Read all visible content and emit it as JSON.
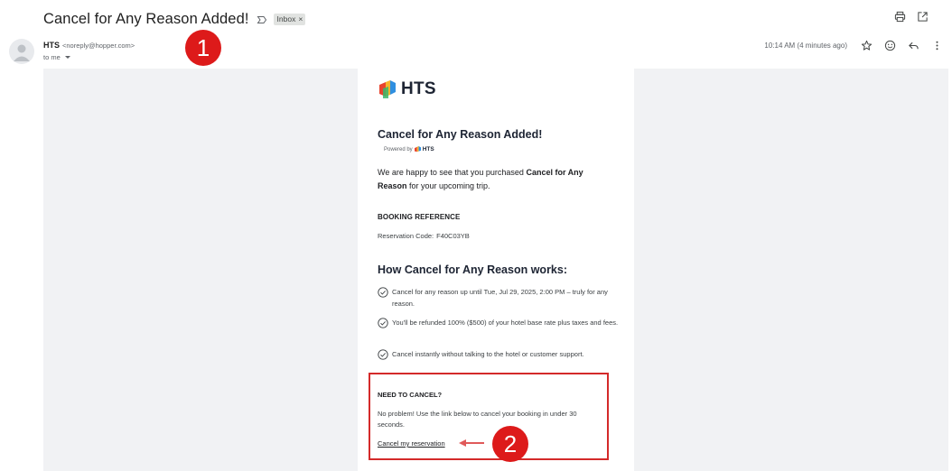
{
  "email": {
    "subject": "Cancel for Any Reason Added!",
    "label": "Inbox",
    "label_close": "×",
    "sender_name": "HTS",
    "sender_email": "<noreply@hopper.com>",
    "to_line": "to me",
    "timestamp": "10:14 AM (4 minutes ago)"
  },
  "body": {
    "logo_text": "HTS",
    "heading": "Cancel for Any Reason Added!",
    "powered_by": "Powered by",
    "powered_brand": "HTS",
    "intro_part1": "We are happy to see that you purchased ",
    "intro_bold": "Cancel for Any Reason",
    "intro_part2": " for your upcoming trip.",
    "booking_heading": "BOOKING REFERENCE",
    "reservation_label": "Reservation Code:",
    "reservation_code": "F40C03YB",
    "how_heading": "How Cancel for Any Reason works:",
    "features": [
      "Cancel for any reason up until Tue, Jul 29, 2025, 2:00 PM – truly for any reason.",
      "You'll be refunded 100% ($500) of your hotel base rate plus taxes and fees.",
      "Cancel instantly without talking to the hotel or customer support."
    ],
    "need_cancel_heading": "NEED TO CANCEL?",
    "need_cancel_text": "No problem! Use the link below to cancel your booking in under 30 seconds.",
    "cancel_link": "Cancel my reservation"
  },
  "annotations": {
    "badge_1": "1",
    "badge_2": "2"
  },
  "colors": {
    "badge_red": "#dd1a1a",
    "highlight_box": "#d42a2a",
    "email_background": "#f1f2f4",
    "brand_dark": "#1d2433"
  },
  "icons": {
    "important": "label-important-icon",
    "print": "print-icon",
    "open_new": "open-in-new-window-icon",
    "star": "star-icon",
    "emoji": "emoji-reaction-icon",
    "reply": "reply-icon",
    "more": "more-vertical-icon",
    "check": "check-circle-icon",
    "arrow": "red-arrow-icon"
  }
}
